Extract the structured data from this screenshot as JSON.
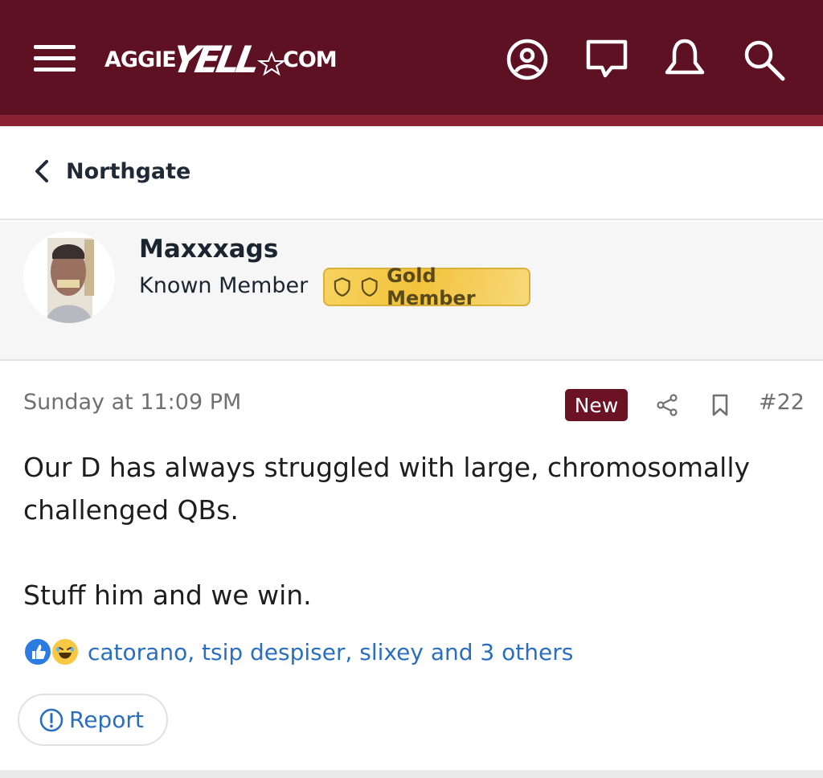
{
  "header": {
    "logo": {
      "part1": "AGGIE",
      "part2": "YELL",
      "part3": "COM"
    },
    "icons": [
      "menu-icon",
      "account-icon",
      "conversations-icon",
      "alerts-icon",
      "search-icon"
    ],
    "colors": {
      "bar": "#5e1123",
      "stripe": "#8a2134"
    }
  },
  "breadcrumb": {
    "label": "Northgate",
    "icon": "chevron-left-icon"
  },
  "user": {
    "name": "Maxxxags",
    "title": "Known Member",
    "badge": {
      "label": "Gold Member",
      "icon": "shield-icon",
      "color": "#f2c23a"
    }
  },
  "post": {
    "date": "Sunday at 11:09 PM",
    "new_label": "New",
    "number": "#22",
    "body": {
      "line1": "Our D has always struggled with large, chromosomally",
      "line2": "challenged QBs.",
      "line3": "Stuff him and we win."
    },
    "reactions": {
      "icons": [
        "like-reaction-icon",
        "haha-reaction-icon"
      ],
      "names": "catorano, tsip despiser, slixey and 3 others"
    },
    "report_label": "Report",
    "accent": "#6b1224",
    "link_color": "#2a6fbf"
  }
}
